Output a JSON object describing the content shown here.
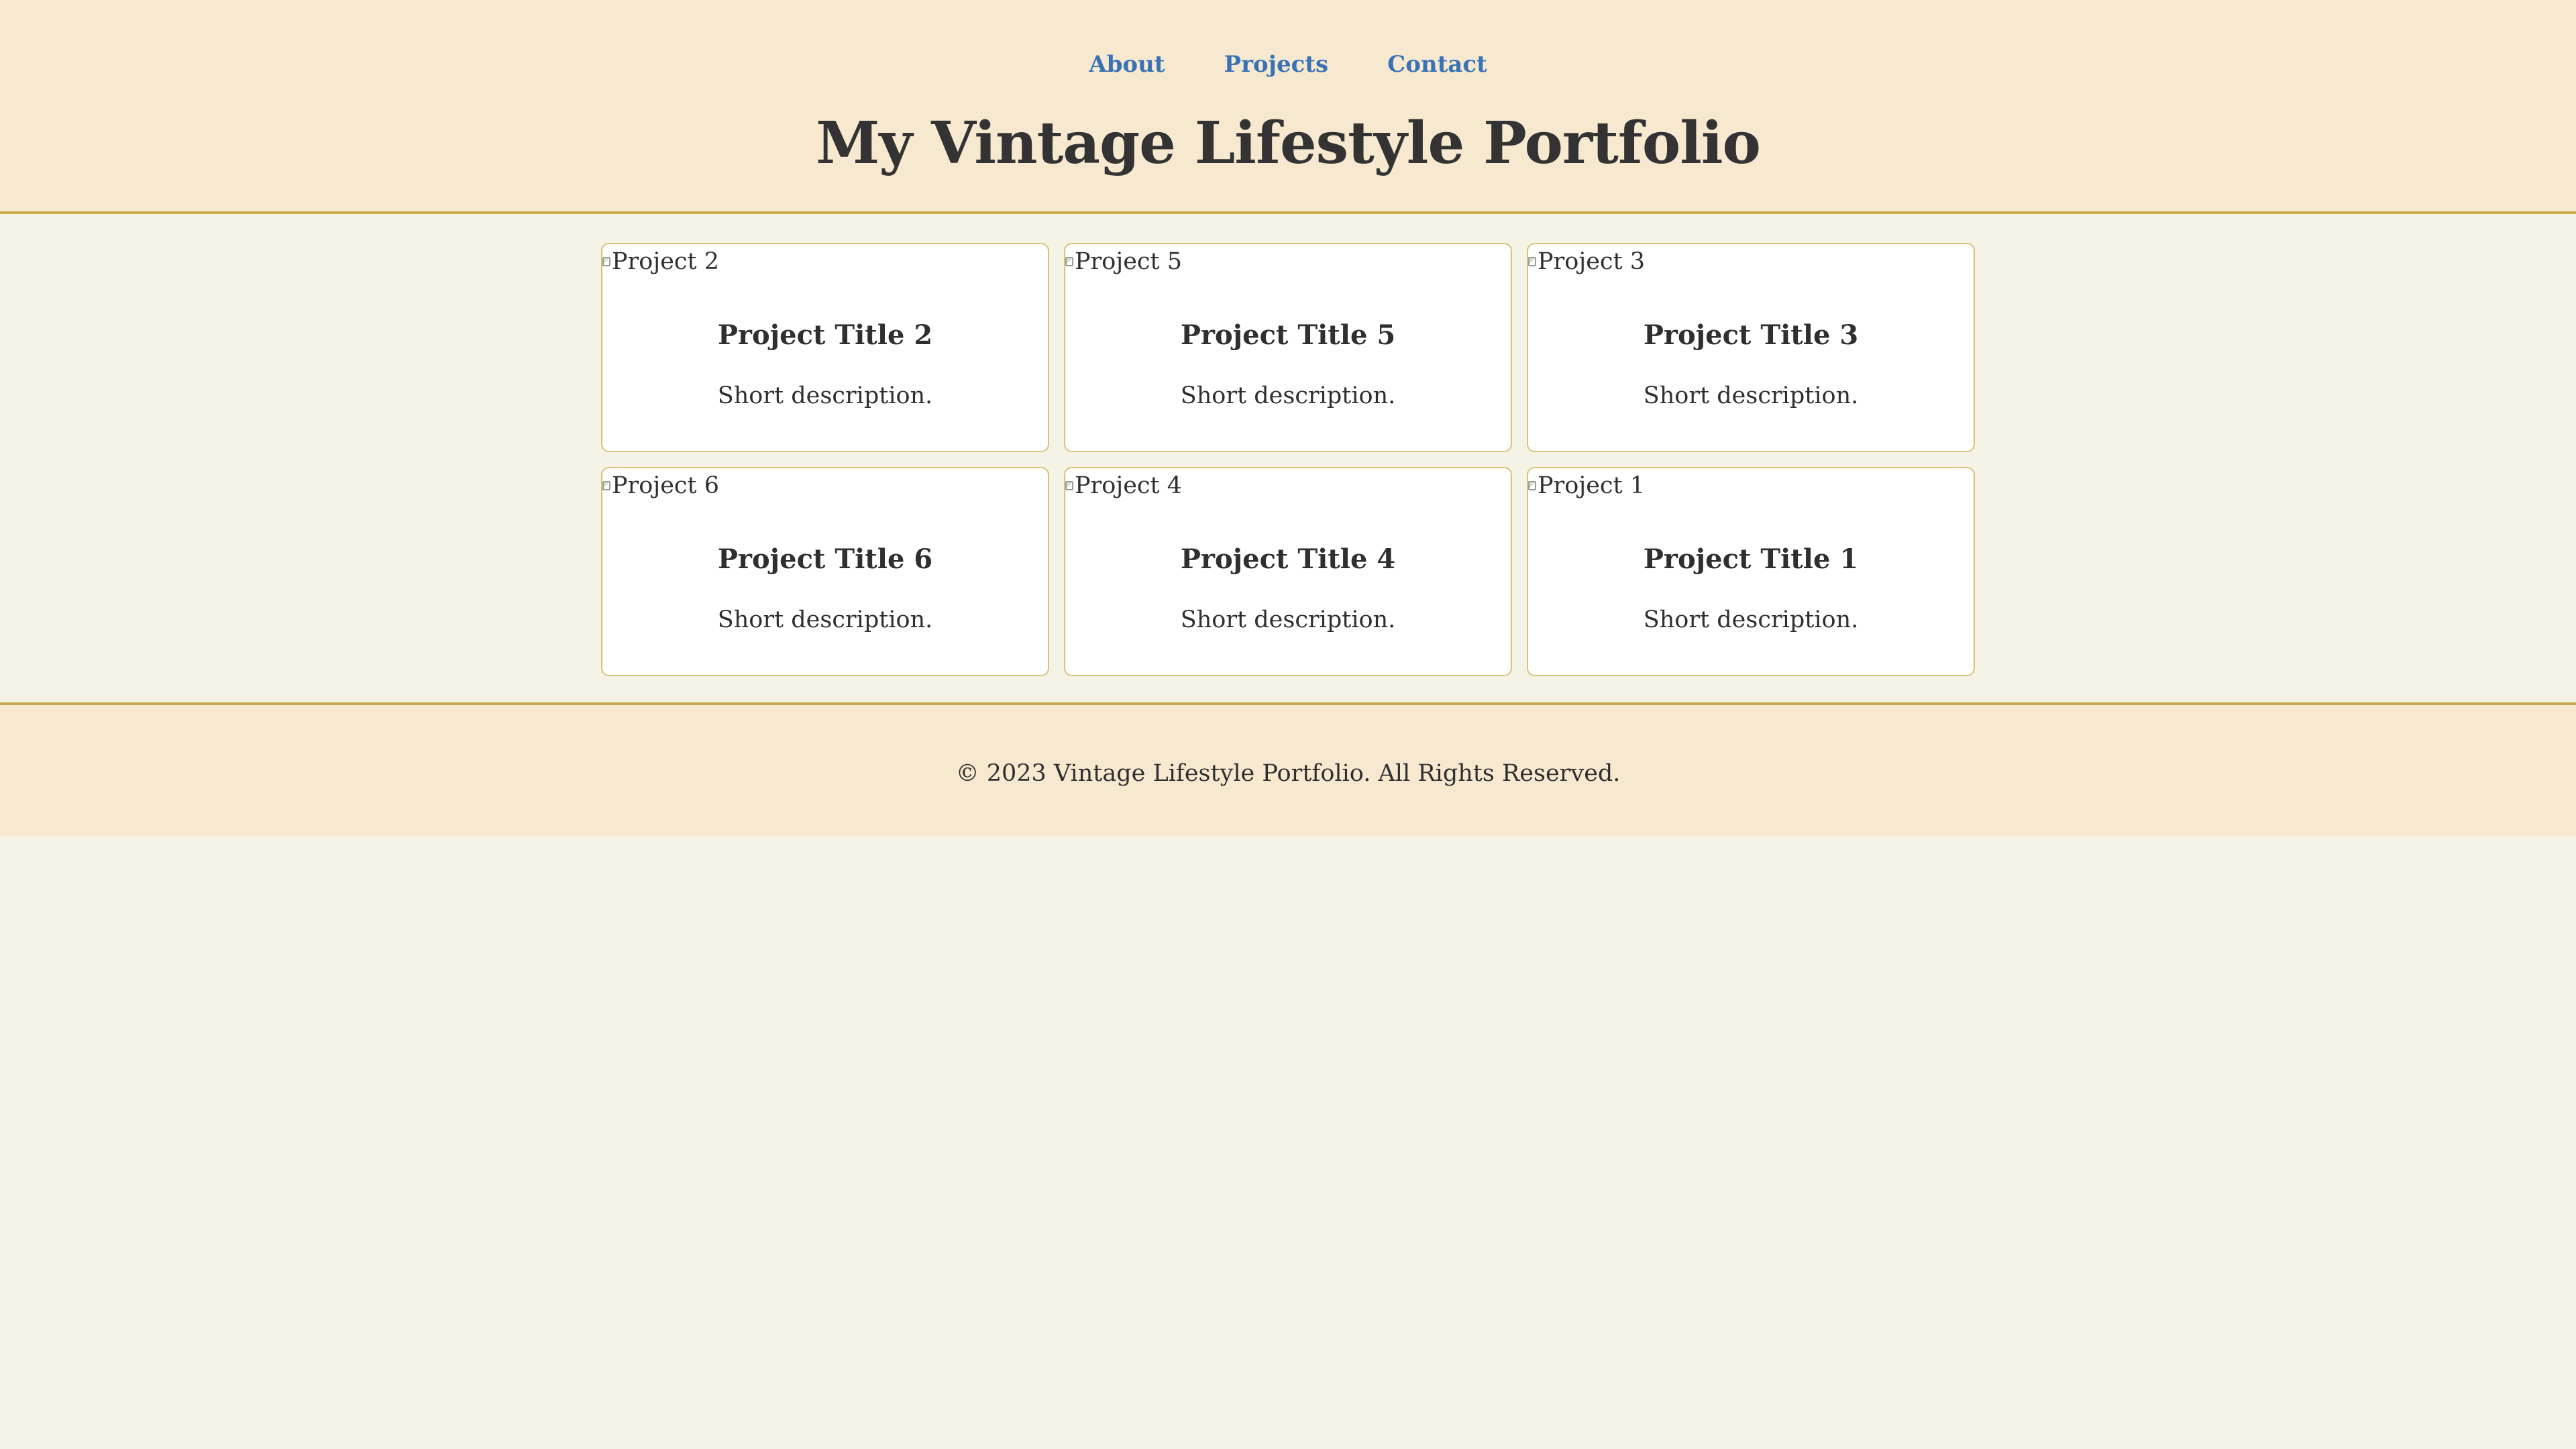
{
  "nav": {
    "items": [
      {
        "label": "About"
      },
      {
        "label": "Projects"
      },
      {
        "label": "Contact"
      }
    ]
  },
  "header": {
    "title": "My Vintage Lifestyle Portfolio"
  },
  "projects": [
    {
      "image_alt": "Project 2",
      "title": "Project Title 2",
      "description": "Short description."
    },
    {
      "image_alt": "Project 5",
      "title": "Project Title 5",
      "description": "Short description."
    },
    {
      "image_alt": "Project 3",
      "title": "Project Title 3",
      "description": "Short description."
    },
    {
      "image_alt": "Project 6",
      "title": "Project Title 6",
      "description": "Short description."
    },
    {
      "image_alt": "Project 4",
      "title": "Project Title 4",
      "description": "Short description."
    },
    {
      "image_alt": "Project 1",
      "title": "Project Title 1",
      "description": "Short description."
    }
  ],
  "footer": {
    "text": "© 2023 Vintage Lifestyle Portfolio. All Rights Reserved."
  },
  "colors": {
    "header_bg": "#f7e9d0",
    "page_bg": "#f5f2e6",
    "accent_border": "#c9a94f",
    "card_border": "#d8c27a",
    "link": "#3a73b5",
    "text": "#2f2f2f"
  },
  "icons": {
    "broken_image": "broken-image-icon"
  }
}
